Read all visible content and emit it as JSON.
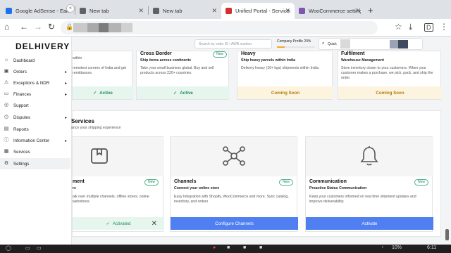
{
  "browser": {
    "tabs": [
      {
        "title": "Google AdSense - Earn Mone",
        "favicon_color": "#1a73e8"
      },
      {
        "title": "New tab",
        "favicon_color": "#5f6368"
      },
      {
        "title": "New tab",
        "favicon_color": "#5f6368"
      },
      {
        "title": "Unified Portal - Services - Log",
        "favicon_color": "#d32f2f"
      },
      {
        "title": "WooCommerce settings ‹ imr",
        "favicon_color": "#7f54b3"
      }
    ],
    "new_tab": "+"
  },
  "sidebar": {
    "logo": "DELHIVERY",
    "collapse": "«",
    "items": [
      {
        "label": "Dashboard",
        "icon": "home-icon",
        "glyph": "⌂"
      },
      {
        "label": "Orders",
        "icon": "box-icon",
        "glyph": "▣",
        "caret": "▸"
      },
      {
        "label": "Exceptions & NDR",
        "icon": "warning-icon",
        "glyph": "⚠",
        "caret": "▸"
      },
      {
        "label": "Finances",
        "icon": "wallet-icon",
        "glyph": "▭",
        "caret": "▸"
      },
      {
        "label": "Support",
        "icon": "support-icon",
        "glyph": "◎"
      },
      {
        "label": "Disputes",
        "icon": "dispute-icon",
        "glyph": "◷",
        "caret": "▸"
      },
      {
        "label": "Reports",
        "icon": "reports-icon",
        "glyph": "▤"
      },
      {
        "label": "Information Center",
        "icon": "info-icon",
        "glyph": "ⓘ",
        "caret": "▸"
      },
      {
        "label": "Services",
        "icon": "services-icon",
        "glyph": "▦"
      },
      {
        "label": "Settings",
        "icon": "settings-icon",
        "glyph": "⚙"
      }
    ]
  },
  "header": {
    "search_placeholder": "Search by order ID / AWB number",
    "profile_label": "Company Profile 20%",
    "profile_progress": 0.2,
    "quick_label": "Quick"
  },
  "top_cards": [
    {
      "title": "",
      "subtitle": "",
      "desc": "remotest corners of India and get remittances.",
      "status": "Active",
      "within": "within"
    },
    {
      "title": "Cross Border",
      "subtitle": "Ship items across continents",
      "desc": "Take your small business global. Buy and sell products across 220+ countries.",
      "status": "Active",
      "badge": "New"
    },
    {
      "title": "Heavy",
      "subtitle": "Ship heavy parcels within India",
      "desc": "Delivery heavy (10+ kgs) shipments within India.",
      "status": "Coming Soon"
    },
    {
      "title": "Fulfilment",
      "subtitle": "Warehouse Management",
      "desc": "Store inventory closer to your customers. When your customer makes a purchase, we pick, pack, and ship the order.",
      "status": "Coming Soon"
    }
  ],
  "services": {
    "title": "Services",
    "subtitle": "ance your shipping experience",
    "cards": [
      {
        "title": "ment",
        "subtitle": "rs",
        "desc": "alk over multiple channels, offline stores, online webstores.",
        "badge": "New",
        "action": "Activated",
        "icon": "package-icon"
      },
      {
        "title": "Channels",
        "subtitle": "Connect your online store",
        "desc": "Easy Integration with Shopify, WooCommerce and more. Sync catalog, inventory, and orders",
        "badge": "New",
        "action": "Configure Channels",
        "icon": "network-icon"
      },
      {
        "title": "Communication",
        "subtitle": "Proactive Status Communication",
        "desc": "Keep your customers informed on real time shipment updates and improve deliverability.",
        "badge": "New",
        "action": "Activate",
        "icon": "bell-icon"
      }
    ]
  },
  "shelf": {
    "status": "10%",
    "time": "6:11"
  }
}
